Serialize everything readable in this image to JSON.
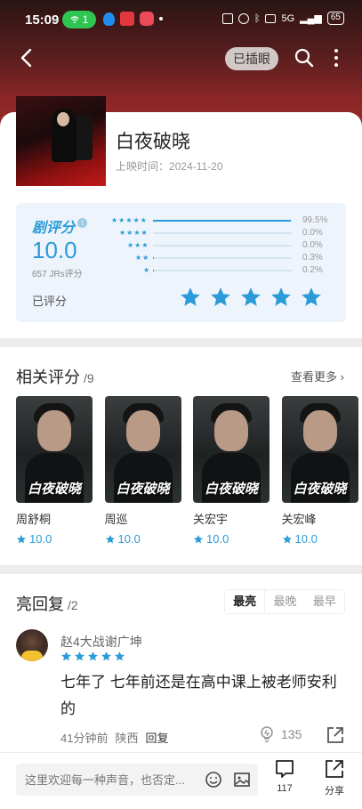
{
  "status_bar": {
    "time": "15:09",
    "wifi_badge": "1",
    "network": "5G",
    "battery": "65"
  },
  "header": {
    "chip_label": "已插眼"
  },
  "work": {
    "title": "白夜破晓",
    "release_label": "上映时间：",
    "release_date": "2024-11-20"
  },
  "rating": {
    "logo": "剧评分",
    "score": "10.0",
    "count": "657 JRs评分",
    "rated_label": "已评分",
    "my_stars": 5,
    "distribution": [
      {
        "stars": "★★★★★",
        "percent": "99.5%",
        "fraction": 0.995
      },
      {
        "stars": "★★★★",
        "percent": "0.0%",
        "fraction": 0.0
      },
      {
        "stars": "★★★",
        "percent": "0.0%",
        "fraction": 0.0
      },
      {
        "stars": "★★",
        "percent": "0.3%",
        "fraction": 0.003
      },
      {
        "stars": "★",
        "percent": "0.2%",
        "fraction": 0.002
      }
    ],
    "accent_color": "#2a9bd8"
  },
  "related": {
    "title": "相关评分",
    "count": "/9",
    "see_more": "查看更多",
    "items": [
      {
        "name": "周舒桐",
        "score": "10.0",
        "caption": "白夜破晓"
      },
      {
        "name": "周巡",
        "score": "10.0",
        "caption": "白夜破晓"
      },
      {
        "name": "关宏宇",
        "score": "10.0",
        "caption": "白夜破晓"
      },
      {
        "name": "关宏峰",
        "score": "10.0",
        "caption": "白夜破晓"
      }
    ]
  },
  "replies": {
    "title": "亮回复",
    "count": "/2",
    "sort_tabs": [
      "最亮",
      "最晚",
      "最早"
    ],
    "first": {
      "user": "赵4大战谢广坤",
      "stars": 5,
      "text": "七年了 七年前还是在高中课上被老师安利的",
      "time": "41分钟前",
      "location": "陕西",
      "reply_label": "回复",
      "likes": "135"
    }
  },
  "bottom_bar": {
    "input_placeholder": "这里欢迎每一种声音，也否定...",
    "comments_count": "117",
    "share_label": "分享"
  }
}
